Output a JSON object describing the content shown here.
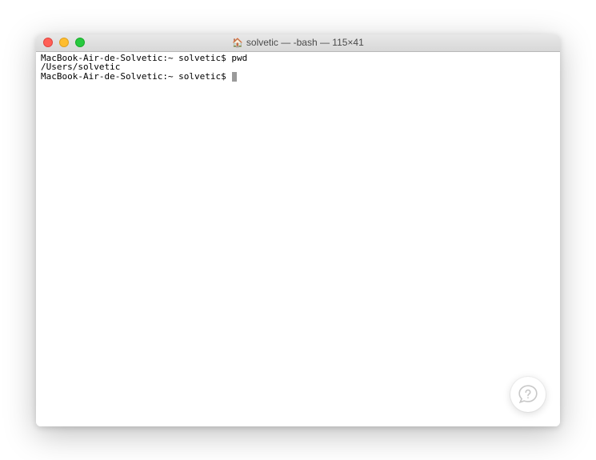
{
  "window": {
    "title": "solvetic — -bash — 115×41",
    "icon": "home-icon"
  },
  "traffic": {
    "close": "close",
    "minimize": "minimize",
    "zoom": "zoom"
  },
  "terminal": {
    "lines": [
      {
        "prompt": "MacBook-Air-de-Solvetic:~ solvetic$ ",
        "command": "pwd"
      },
      {
        "output": "/Users/solvetic"
      },
      {
        "prompt": "MacBook-Air-de-Solvetic:~ solvetic$ ",
        "command": "",
        "cursor": true
      }
    ]
  },
  "chat": {
    "label": "chat-help"
  }
}
